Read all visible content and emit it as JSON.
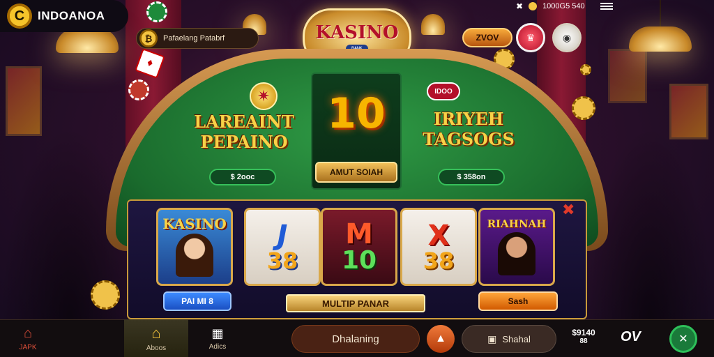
{
  "app": {
    "name": "INDOANOA",
    "logo_glyph": "C"
  },
  "promo": {
    "text": "Pafaelang Patabrf",
    "coin_glyph": "₿"
  },
  "status": {
    "time": "1000G5 540"
  },
  "header_actions": {
    "btn1": "ZVOV",
    "btn2": "",
    "btn3": ""
  },
  "logo": {
    "title": "KASINO",
    "subtitle": "ᴮᴬᴺᴷ"
  },
  "table": {
    "left_title_line1": "LAREAINT",
    "left_title_line2": "PEPAINO",
    "left_amount": "$ 2ooc",
    "center_number": "10",
    "center_button": "AMUT SOIAH",
    "right_badge": "IDOO",
    "right_title_line1": "IRIYEH",
    "right_title_line2": "TAGSOGS",
    "right_amount": "$ 358on"
  },
  "games": [
    {
      "id": "kasino",
      "title": "KASINO",
      "button": "PAI MI 8"
    },
    {
      "id": "j38",
      "line1": "J",
      "line2": "38"
    },
    {
      "id": "m10",
      "line1": "M",
      "line2": "10"
    },
    {
      "id": "x38",
      "line1": "X",
      "line2": "38"
    },
    {
      "id": "player",
      "title": "RIAHNAH",
      "button": "Sash"
    }
  ],
  "center_ribbon": "MULTIP PANAR",
  "navbar": {
    "items": [
      {
        "label": "JAPK"
      },
      {
        "label": "Aboos"
      },
      {
        "label": "Adics"
      }
    ],
    "main_pill": "Dhalaning",
    "search_pill": "Shahal",
    "balance": "$9140",
    "balance_sub": "88",
    "right_text": "OV"
  },
  "colors": {
    "accent_gold": "#f7d247",
    "felt_green": "#1a6b2d",
    "panel": "#1e1640"
  }
}
